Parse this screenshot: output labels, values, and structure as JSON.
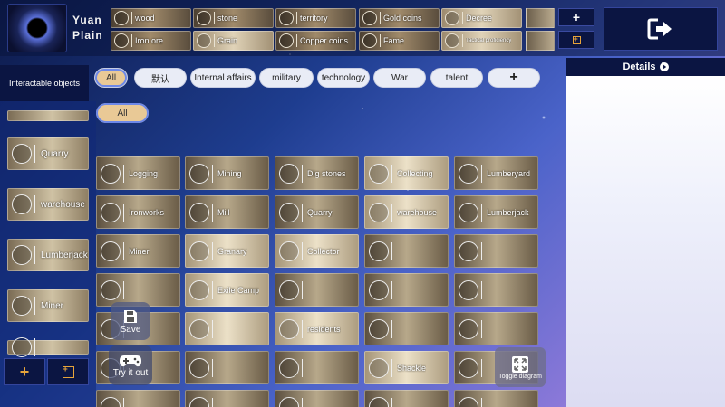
{
  "player": {
    "name": "Yuan\nPlain"
  },
  "resources": [
    {
      "label": "wood",
      "style": "dark"
    },
    {
      "label": "stone",
      "style": "dark"
    },
    {
      "label": "territory",
      "style": "dark"
    },
    {
      "label": "Gold coins",
      "style": "dark"
    },
    {
      "label": "Decree",
      "style": "light"
    },
    {
      "label": "Iron ore",
      "style": "dark"
    },
    {
      "label": "Grain",
      "style": "light"
    },
    {
      "label": "Copper coins",
      "style": "dark"
    },
    {
      "label": "Fame",
      "style": "dark"
    },
    {
      "label": "Tactical proficiency",
      "style": "light",
      "small": true
    }
  ],
  "top_buttons": {
    "add": "+",
    "exit_icon": "exit-icon"
  },
  "filters": {
    "section_label": "Interactable objects",
    "tabs": [
      "All",
      "默认",
      "Internal affairs",
      "military",
      "technology",
      "War",
      "talent",
      "+"
    ],
    "active_tab": "All",
    "sub_tabs": [
      "All"
    ]
  },
  "sidebar_items": [
    "Quarry",
    "warehouse",
    "Lumberjack",
    "Miner",
    ""
  ],
  "sidebar_bottom": {
    "add": "+",
    "add_alt": "+"
  },
  "cards": [
    "Logging",
    "Mining",
    "Dig stones",
    "Collecting",
    "Lumberyard",
    "Ironworks",
    "Mill",
    "Quarry",
    "warehouse",
    "Lumberjack",
    "Miner",
    "Granary",
    "Collector",
    "",
    "",
    "",
    "Exile Camp",
    "",
    "",
    "",
    "",
    "",
    "residents",
    "",
    "",
    "",
    "",
    "",
    "Shackle",
    "",
    "",
    "",
    "",
    "",
    ""
  ],
  "float_buttons": {
    "save": "Save",
    "try": "Try it out",
    "toggle": "Toggle diagram"
  },
  "right_panel": {
    "title": "Details"
  },
  "colors": {
    "accent": "#e7a43a",
    "panel": "#0b1542",
    "active_pill": "#e9c996"
  }
}
